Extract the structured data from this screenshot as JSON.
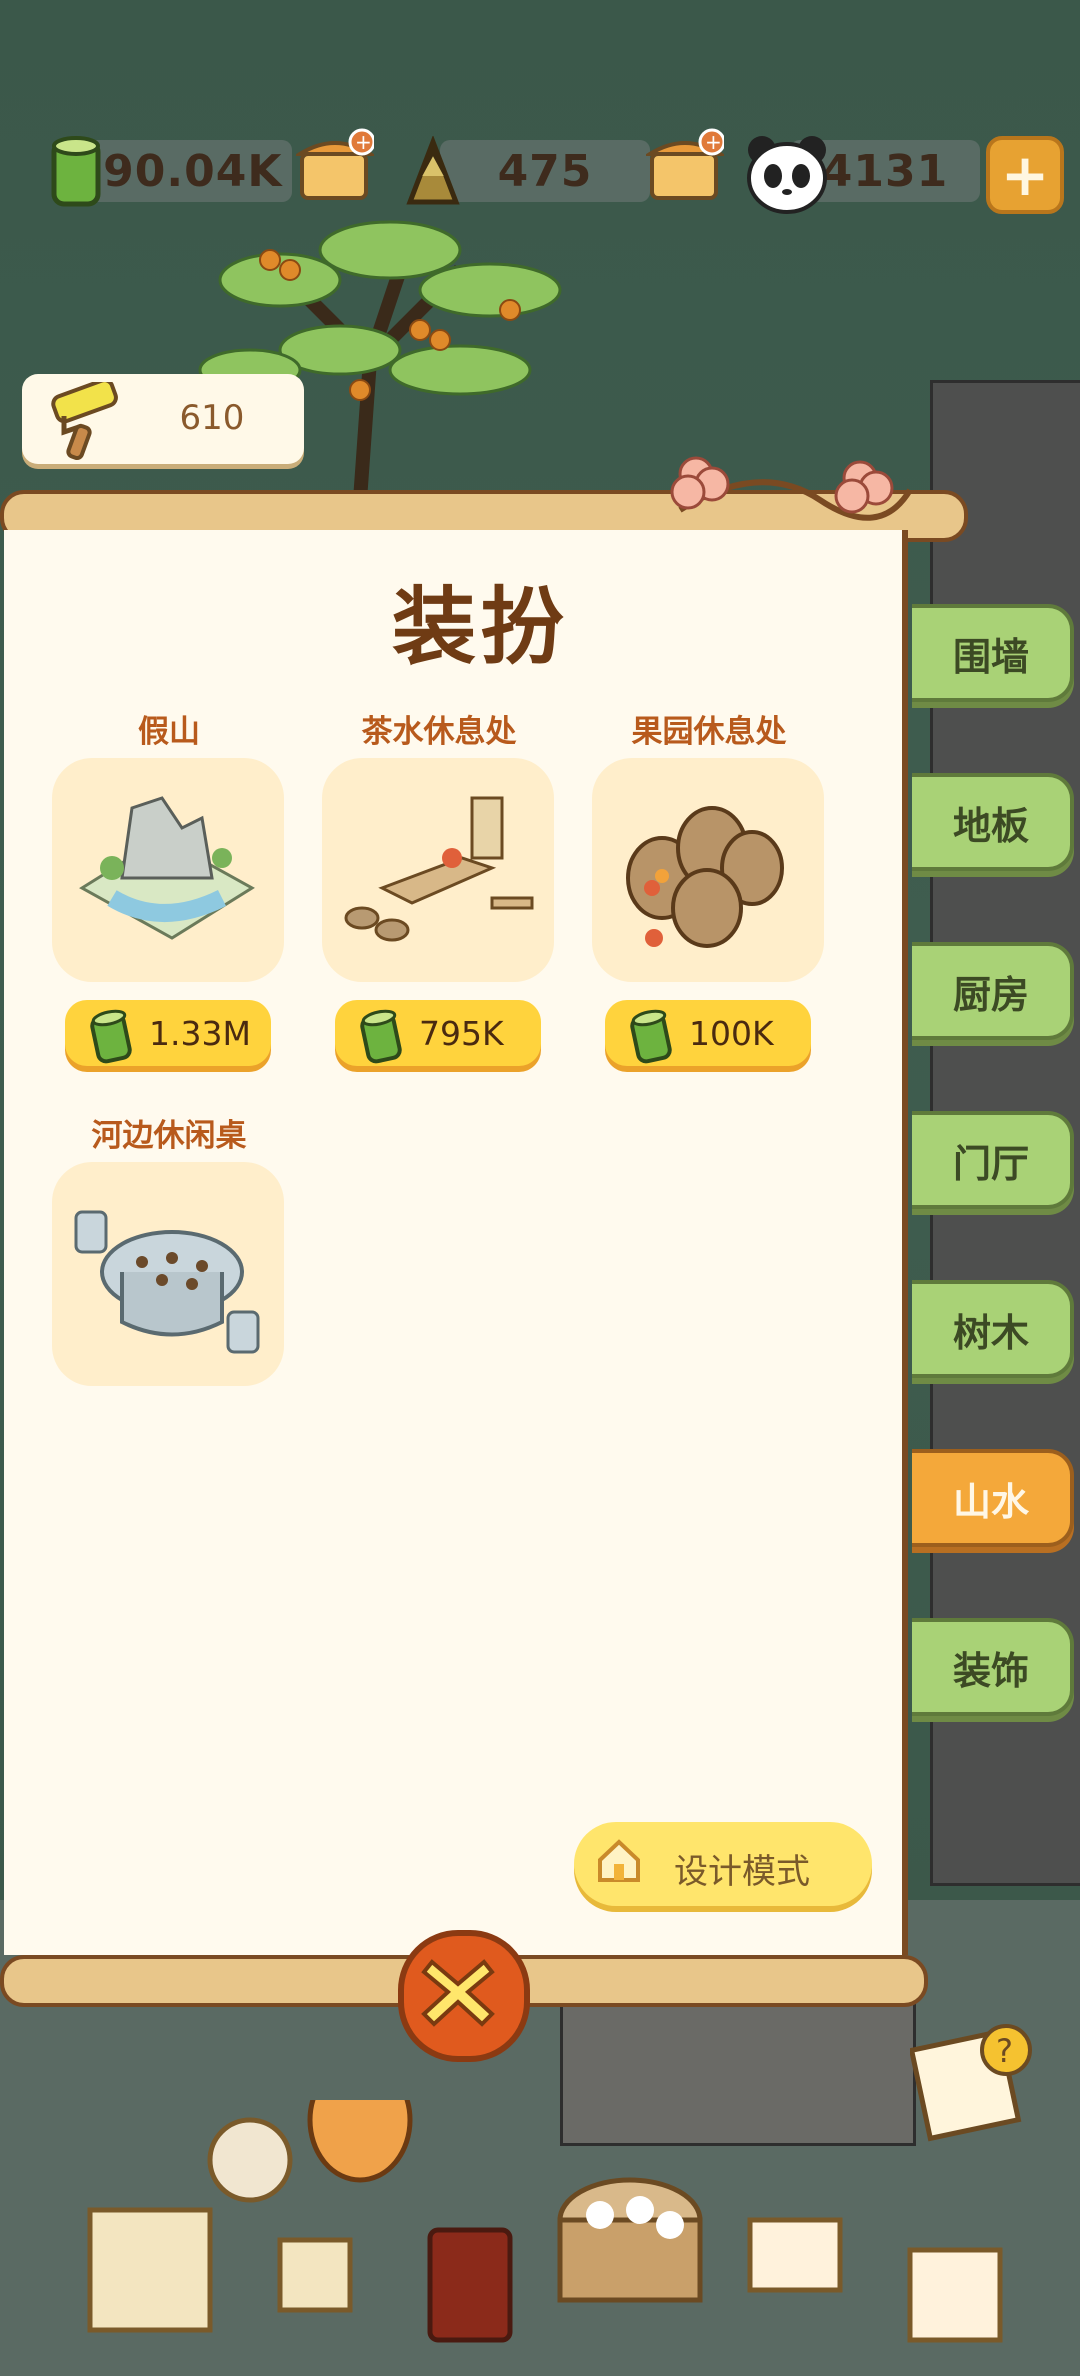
{
  "resources": {
    "bamboo_amount": "490.04K",
    "shoot_amount": "475",
    "panda_amount": "4131",
    "plus_label": "+"
  },
  "roller": {
    "value": "610"
  },
  "panel": {
    "title": "装扮"
  },
  "items": [
    {
      "name": "假山",
      "price": "1.33M"
    },
    {
      "name": "茶水休息处",
      "price": "795K"
    },
    {
      "name": "果园休息处",
      "price": "100K"
    },
    {
      "name": "河边休闲桌",
      "price": ""
    }
  ],
  "tabs": [
    {
      "label": "围墙",
      "active": false
    },
    {
      "label": "地板",
      "active": false
    },
    {
      "label": "厨房",
      "active": false
    },
    {
      "label": "门厅",
      "active": false
    },
    {
      "label": "树木",
      "active": false
    },
    {
      "label": "山水",
      "active": true
    },
    {
      "label": "装饰",
      "active": false
    }
  ],
  "design_button": {
    "label": "设计模式"
  },
  "colors": {
    "accent": "#f4a83a",
    "tab_green": "#a9d276",
    "price_yellow": "#ffd33d",
    "panel": "#fffaee"
  }
}
